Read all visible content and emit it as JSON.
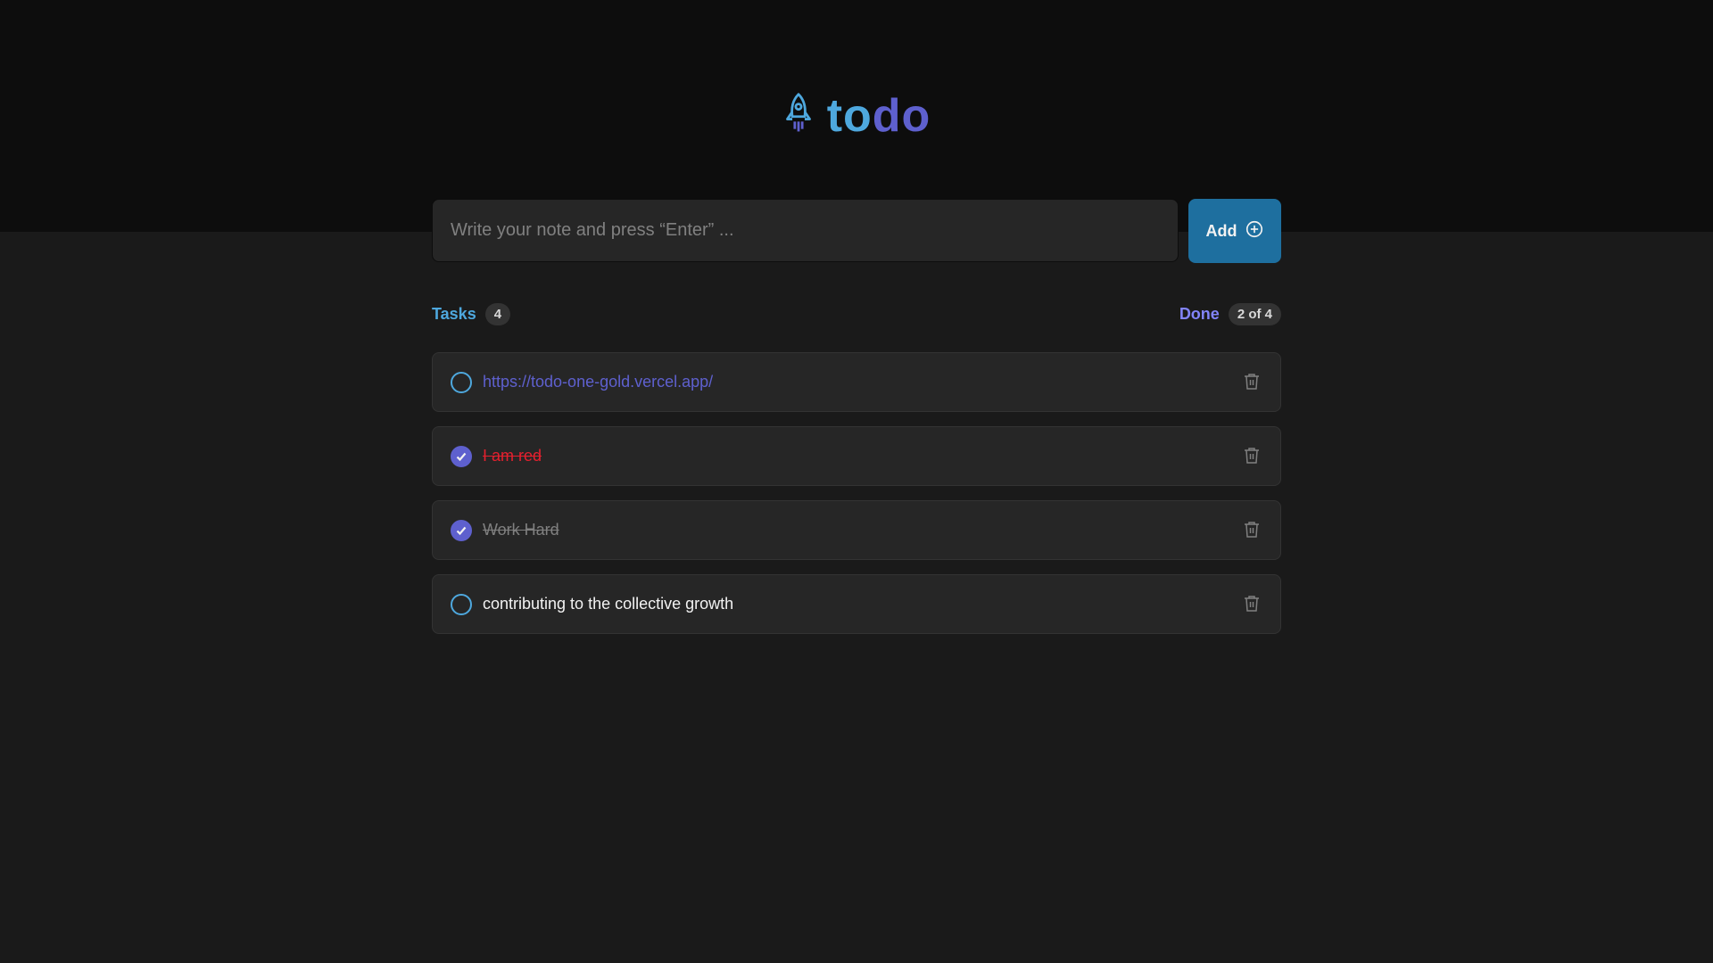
{
  "logo": {
    "text_part1": "to",
    "text_part2": "do",
    "icon": "rocket-icon"
  },
  "new_task": {
    "placeholder": "Write your note and press “Enter” ...",
    "value": "",
    "add_label": "Add",
    "add_icon": "plus-circle-icon"
  },
  "counters": {
    "tasks_label": "Tasks",
    "tasks_count": "4",
    "done_label": "Done",
    "done_count": "2 of 4"
  },
  "tasks": [
    {
      "text": "https://todo-one-gold.vercel.app/",
      "completed": false,
      "style": "link"
    },
    {
      "text": "I am red",
      "completed": true,
      "style": "red"
    },
    {
      "text": "Work Hard",
      "completed": true,
      "style": "done"
    },
    {
      "text": "contributing to the collective growth",
      "completed": false,
      "style": "normal"
    }
  ],
  "colors": {
    "blue": "#4ea8de",
    "purple": "#5e60ce",
    "button_bg": "#1e6f9f",
    "red": "#e5202e",
    "background": "#1a1a1a",
    "header_bg": "#0d0d0d"
  }
}
